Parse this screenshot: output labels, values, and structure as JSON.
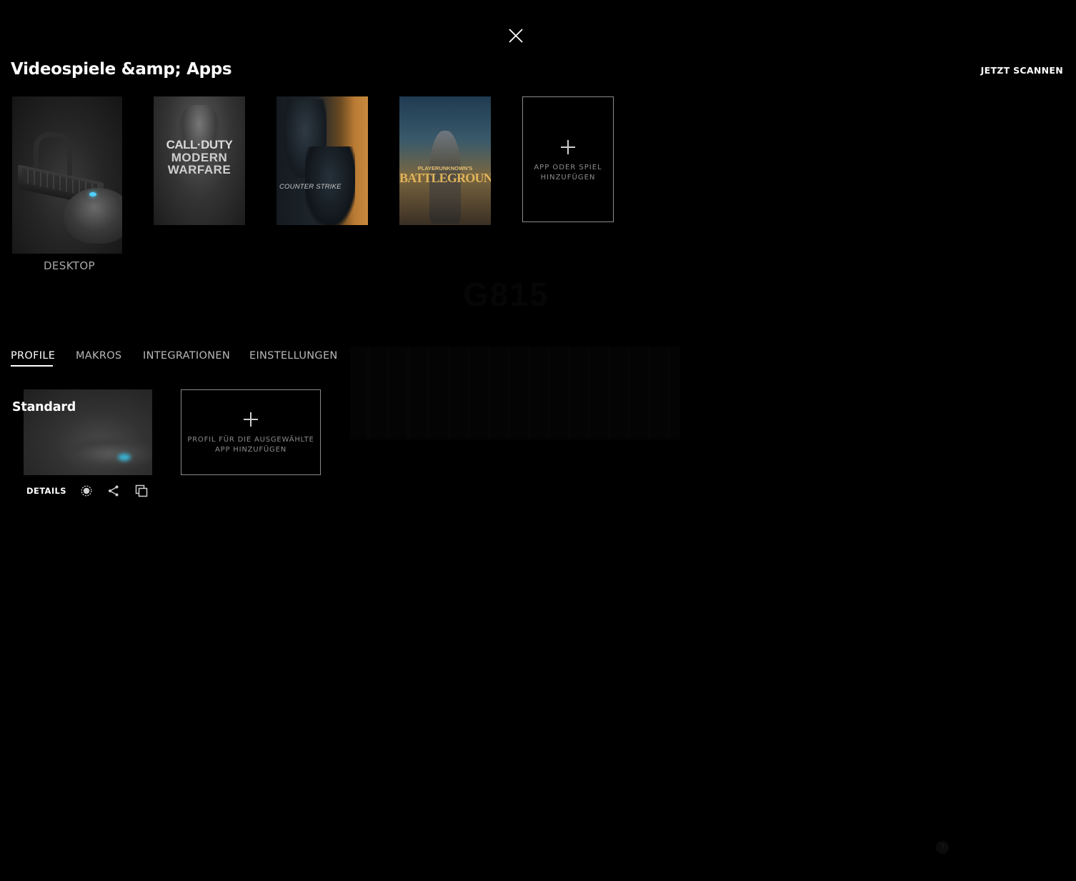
{
  "header": {
    "title": "Videospiele &amp; Apps",
    "scan_label": "JETZT SCANNEN",
    "close_icon": "close-icon"
  },
  "apps": {
    "desktop_label": "DESKTOP",
    "cod": {
      "line1": "CALL·DUTY",
      "line2": "MODERN",
      "line3": "WARFARE"
    },
    "cs": {
      "title": "COUNTER STRIKE"
    },
    "pubg": {
      "line1": "PLAYERUNKNOWN'S",
      "line2": "BATTLEGROUNDS"
    },
    "add_label": "APP ODER SPIEL HINZUFÜGEN"
  },
  "tabs": [
    {
      "label": "PROFILE",
      "active": true
    },
    {
      "label": "MAKROS",
      "active": false
    },
    {
      "label": "INTEGRATIONEN",
      "active": false
    },
    {
      "label": "EINSTELLUNGEN",
      "active": false
    }
  ],
  "profiles": {
    "card": {
      "name": "Standard",
      "details_label": "DETAILS",
      "icons": [
        "persistent-profile-icon",
        "share-icon",
        "duplicate-icon"
      ]
    },
    "add_label": "PROFIL FÜR DIE AUSGEWÄHLTE APP HINZUFÜGEN"
  },
  "colors": {
    "background": "#000000",
    "text_primary": "#ffffff",
    "text_secondary": "#8c8c8c",
    "led_accent": "#4fd0ff"
  }
}
